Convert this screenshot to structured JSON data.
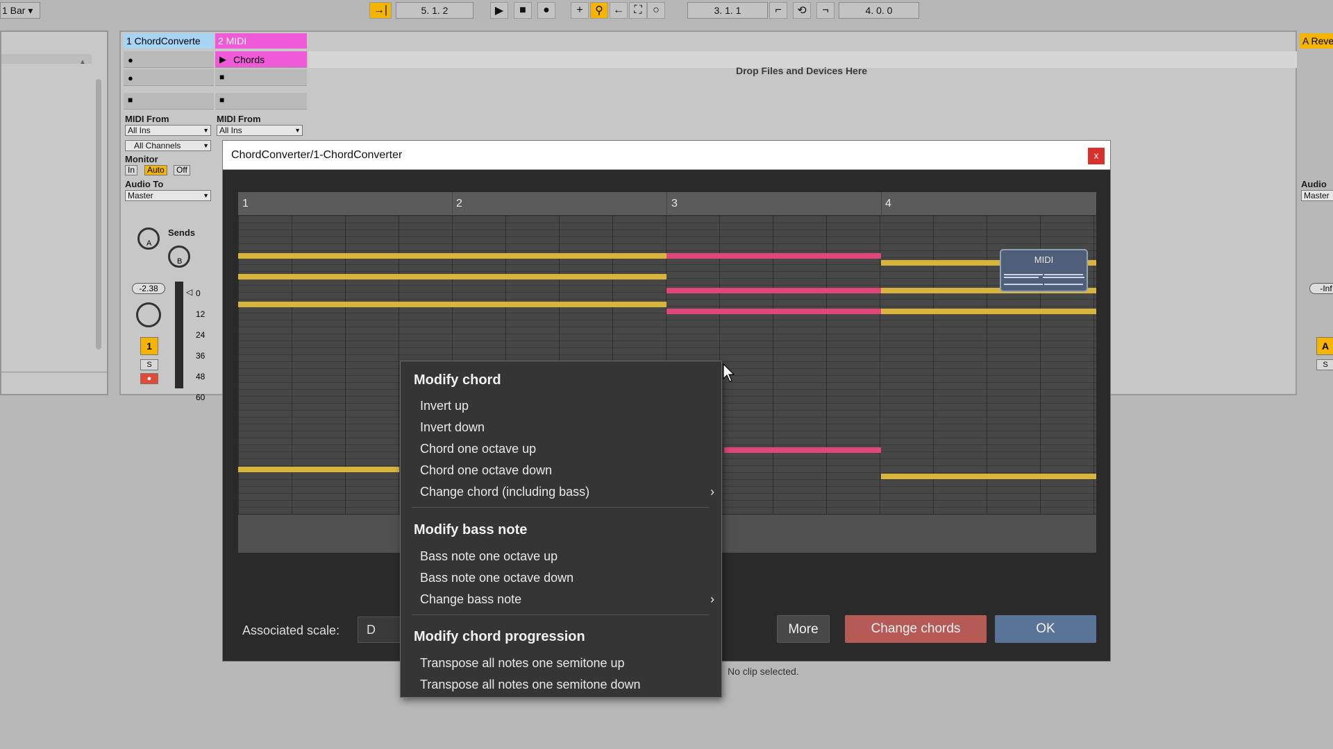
{
  "transport": {
    "quantize": "1 Bar",
    "position": "5.   1.   2",
    "loop_start": "3.   1.   1",
    "loop_length": "4.   0.   0"
  },
  "session": {
    "drop_hint": "Drop Files and Devices Here",
    "no_clip": "No clip selected.",
    "tracks": [
      {
        "name": "1 ChordConverte",
        "color": "#a8d4f4"
      },
      {
        "name": "2 MIDI",
        "color": "#f05ad8",
        "clip": "Chords"
      }
    ],
    "return_track": {
      "name": "A Reve",
      "color": "#f4b400"
    },
    "midi_from_label": "MIDI From",
    "midi_from_value": "All Ins",
    "channel_value": "All Channels",
    "monitor_label": "Monitor",
    "monitor_in": "In",
    "monitor_auto": "Auto",
    "monitor_off": "Off",
    "audio_to_label": "Audio To",
    "audio_to_value": "Master",
    "return_audio_to_label": "Audio T",
    "return_audio_to_value": "Master",
    "sends_label": "Sends",
    "send_a": "A",
    "send_b": "B",
    "volume": "-2.38",
    "return_volume": "-Inf",
    "meter_scale": [
      "0",
      "12",
      "24",
      "36",
      "48",
      "60"
    ],
    "track_number": "1",
    "return_track_letter": "A",
    "solo": "S"
  },
  "dialog": {
    "title": "ChordConverter/1-ChordConverter",
    "close": "x",
    "bars": [
      "1",
      "2",
      "3",
      "4"
    ],
    "midi_badge": "MIDI",
    "scale_label": "Associated scale:",
    "scale_value": "D",
    "buttons": {
      "more": "More",
      "change": "Change chords",
      "ok": "OK"
    },
    "colors": {
      "chord": "#d9b53c",
      "selected_chord": "#e0457b",
      "change_button": "#b55a55",
      "ok_button": "#5a7399"
    }
  },
  "menu": {
    "sections": [
      {
        "header": "Modify chord",
        "items": [
          "Invert up",
          "Invert down",
          "Chord one octave up",
          "Chord one octave down",
          "Change chord (including bass)"
        ]
      },
      {
        "header": "Modify bass note",
        "items": [
          "Bass note one octave up",
          "Bass note one octave down",
          "Change bass note"
        ]
      },
      {
        "header": "Modify chord progression",
        "items": [
          "Transpose all notes one semitone up",
          "Transpose all notes one semitone down"
        ]
      }
    ]
  }
}
